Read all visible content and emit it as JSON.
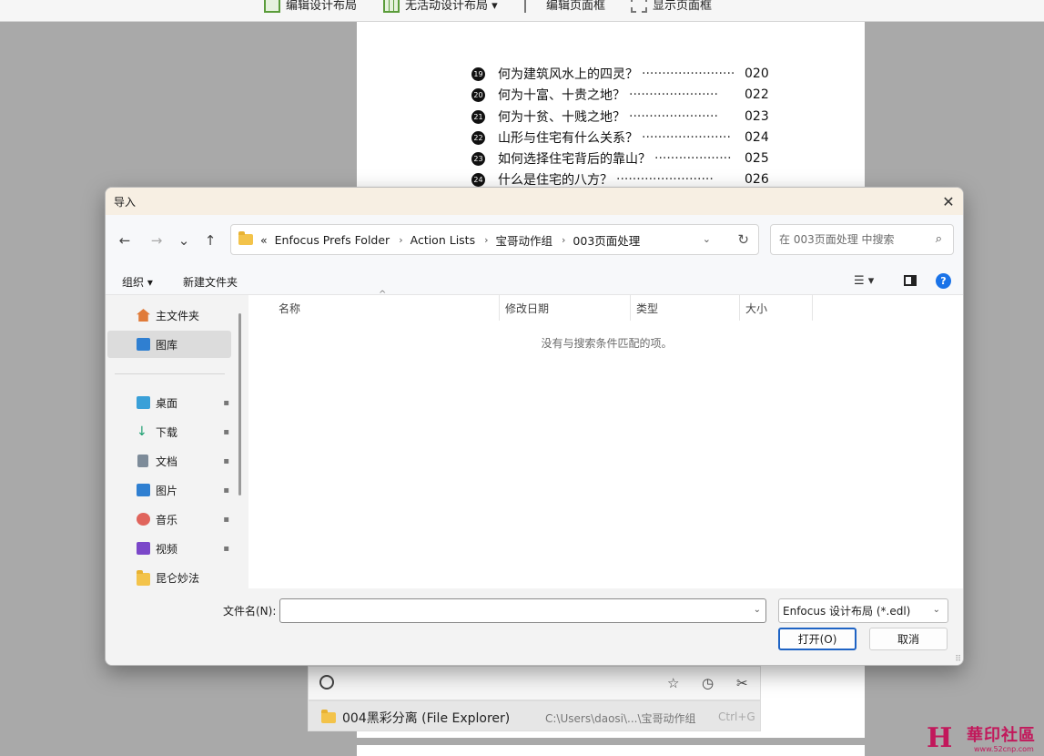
{
  "app_toolbar": {
    "items": [
      {
        "label": "编辑设计布局",
        "icon": "layout-edit-icon"
      },
      {
        "label": "无活动设计布局 ▾",
        "icon": "layout-grid-icon"
      },
      {
        "label": "编辑页面框",
        "icon": "crop-icon"
      },
      {
        "label": "显示页面框",
        "icon": "frame-icon"
      }
    ]
  },
  "document": {
    "toc": [
      {
        "num": "19",
        "title": "何为建筑风水上的四灵？",
        "dots": "·······················",
        "page": "020"
      },
      {
        "num": "20",
        "title": "何为十富、十贵之地？",
        "dots": " ······················",
        "page": "022"
      },
      {
        "num": "21",
        "title": "何为十贫、十贱之地？",
        "dots": " ······················",
        "page": "023"
      },
      {
        "num": "22",
        "title": "山形与住宅有什么关系？",
        "dots": "······················",
        "page": "024"
      },
      {
        "num": "23",
        "title": "如何选择住宅背后的靠山？",
        "dots": "···················",
        "page": "025"
      },
      {
        "num": "24",
        "title": "什么是住宅的八方？",
        "dots": "························",
        "page": "026"
      }
    ]
  },
  "dialog": {
    "title": "导入",
    "close_glyph": "✕",
    "nav": {
      "back": "←",
      "forward": "→",
      "recent": "⌄",
      "up": "↑",
      "refresh": "↻",
      "addr_dropdown": "⌄"
    },
    "breadcrumb": {
      "overflow": "«",
      "items": [
        "Enfocus Prefs Folder",
        "Action Lists",
        "宝哥动作组",
        "003页面处理"
      ],
      "separator": "›"
    },
    "search": {
      "placeholder": "在 003页面处理 中搜索",
      "icon": "⌕"
    },
    "commands": {
      "organize": "组织 ▾",
      "new_folder": "新建文件夹",
      "view": "☰ ▾",
      "help": "?"
    },
    "sidebar": {
      "items": [
        {
          "label": "主文件夹",
          "icon": "home-icon",
          "color": "#e07b39",
          "pinned": false
        },
        {
          "label": "图库",
          "icon": "gallery-icon",
          "color": "#2f7fd1",
          "pinned": false
        },
        {
          "label": "桌面",
          "icon": "desktop-icon",
          "color": "#3aa0d8",
          "pinned": true
        },
        {
          "label": "下载",
          "icon": "download-icon",
          "color": "#1a9e6f",
          "pinned": true
        },
        {
          "label": "文档",
          "icon": "document-icon",
          "color": "#7d8b99",
          "pinned": true
        },
        {
          "label": "图片",
          "icon": "pictures-icon",
          "color": "#2f7fd1",
          "pinned": true
        },
        {
          "label": "音乐",
          "icon": "music-icon",
          "color": "#e0645c",
          "pinned": true
        },
        {
          "label": "视频",
          "icon": "video-icon",
          "color": "#7b47c9",
          "pinned": true
        },
        {
          "label": "昆仑妙法",
          "icon": "folder-icon",
          "color": "#f3c34a",
          "pinned": false
        }
      ],
      "pin_glyph": "📌"
    },
    "columns": [
      "名称",
      "修改日期",
      "类型",
      "大小"
    ],
    "sort_arrow": "^",
    "empty_message": "没有与搜索条件匹配的项。",
    "filename": {
      "label": "文件名(N):",
      "value": "",
      "dropdown": "⌄"
    },
    "filetype": {
      "selected": "Enfocus 设计布局 (*.edl)",
      "dropdown": "⌄"
    },
    "buttons": {
      "open": "打开(O)",
      "cancel": "取消"
    },
    "grip": "⠿"
  },
  "quick_open": {
    "icons": {
      "search": "search-icon",
      "star": "☆",
      "history": "◷",
      "tools": "✂"
    },
    "result": {
      "name": "004黑彩分离 (File Explorer)",
      "path": "C:\\Users\\daosi\\...\\宝哥动作组",
      "shortcut": "Ctrl+G"
    }
  },
  "watermark": {
    "logo": "H",
    "text": "華印社區",
    "sub": "www.52cnp.com"
  },
  "colors": {
    "accent": "#1e63c4",
    "title_bar": "#f7efe3",
    "selected_nav": "#dcdcdc"
  }
}
